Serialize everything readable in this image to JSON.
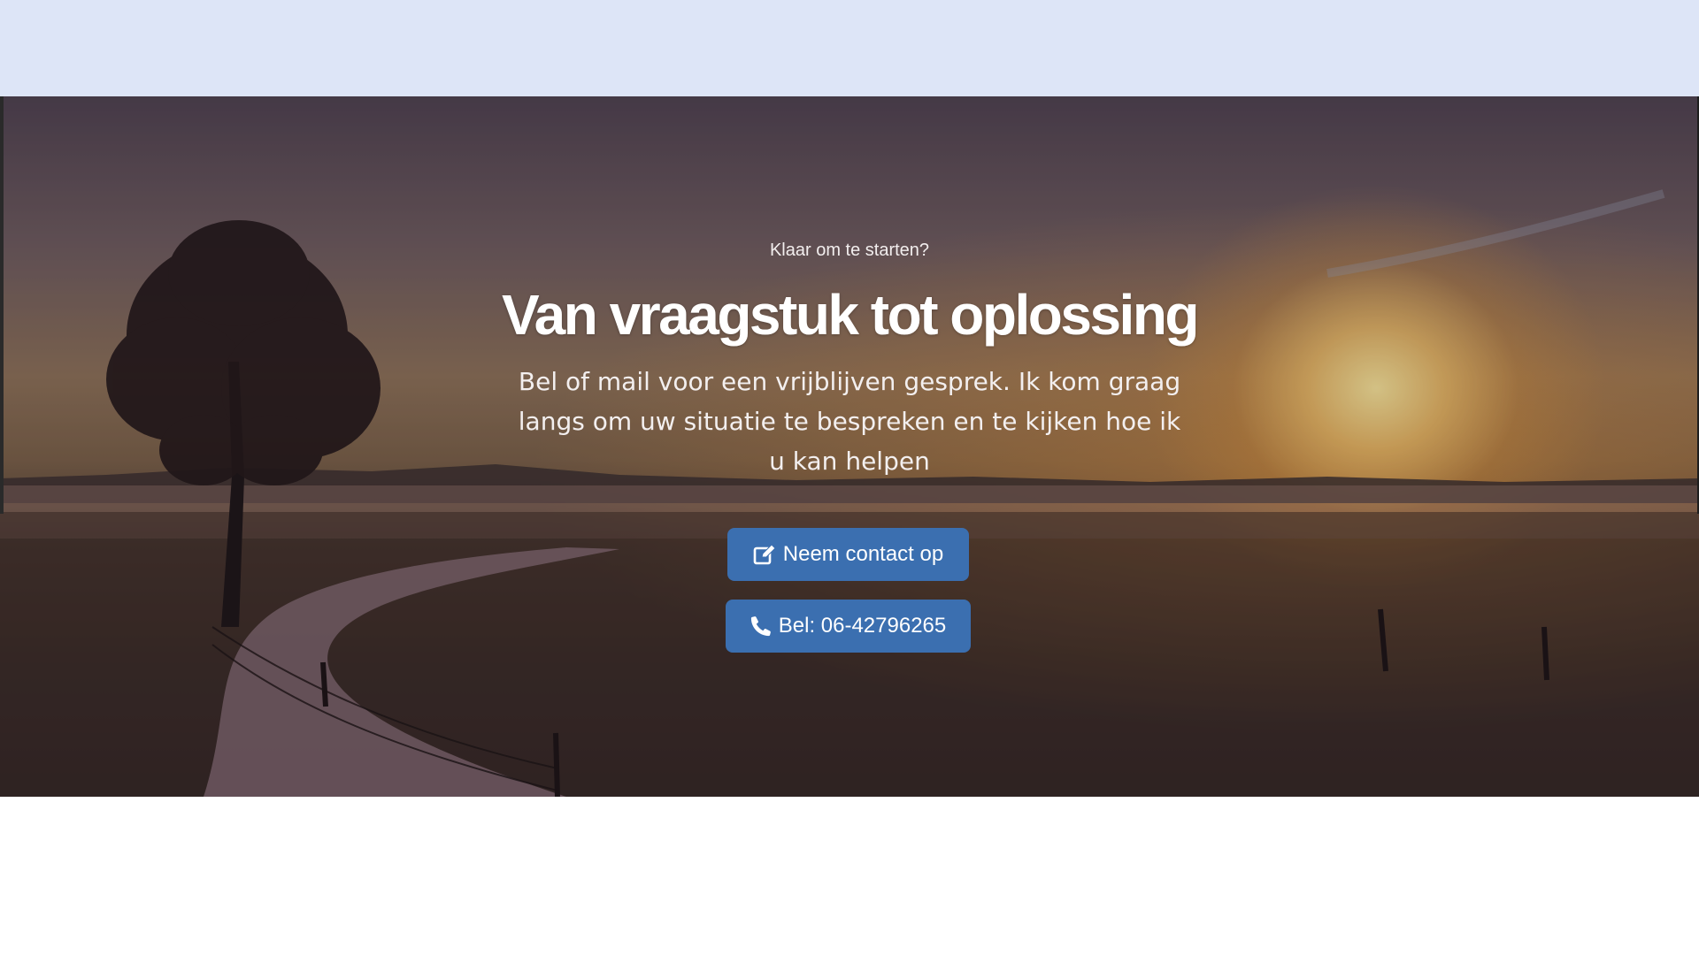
{
  "hero": {
    "eyebrow": "Klaar om te starten?",
    "headline": "Van vraagstuk tot oplossing",
    "lead": "Bel of mail voor een vrijblijven gesprek. Ik kom graag langs om uw situatie te bespreken en te kijken hoe ik u kan helpen",
    "buttons": {
      "contact_label": "Neem contact op",
      "contact_icon": "edit-icon",
      "call_label": "Bel: 06-42796265",
      "call_icon": "phone-icon"
    }
  },
  "colors": {
    "top_band": "#dde5f7",
    "button": "#3b6fb0",
    "text": "#ffffff"
  }
}
